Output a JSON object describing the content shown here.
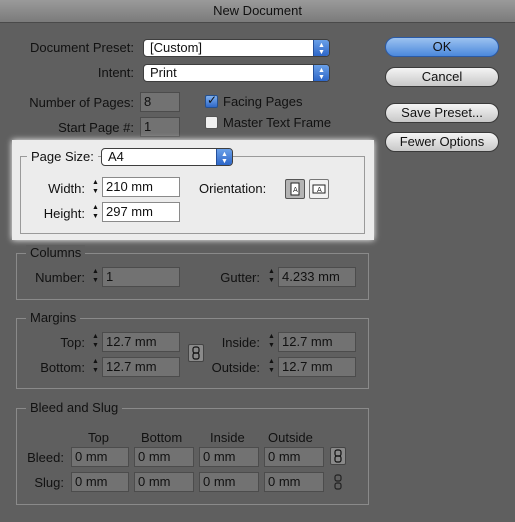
{
  "window": {
    "title": "New Document"
  },
  "document": {
    "preset_label": "Document Preset:",
    "preset_value": "[Custom]",
    "intent_label": "Intent:",
    "intent_value": "Print",
    "pages_label": "Number of Pages:",
    "pages_value": "8",
    "start_label": "Start Page #:",
    "start_value": "1",
    "facing_label": "Facing Pages",
    "facing_checked": true,
    "master_label": "Master Text Frame",
    "master_checked": false
  },
  "buttons": {
    "ok": "OK",
    "cancel": "Cancel",
    "save_preset": "Save Preset...",
    "fewer_options": "Fewer Options"
  },
  "page_size": {
    "label": "Page Size:",
    "value": "A4",
    "width_label": "Width:",
    "width_value": "210 mm",
    "height_label": "Height:",
    "height_value": "297 mm",
    "orientation_label": "Orientation:",
    "orientation_selected": "portrait"
  },
  "columns": {
    "title": "Columns",
    "number_label": "Number:",
    "number_value": "1",
    "gutter_label": "Gutter:",
    "gutter_value": "4.233 mm"
  },
  "margins": {
    "title": "Margins",
    "top_label": "Top:",
    "top_value": "12.7 mm",
    "bottom_label": "Bottom:",
    "bottom_value": "12.7 mm",
    "inside_label": "Inside:",
    "inside_value": "12.7 mm",
    "outside_label": "Outside:",
    "outside_value": "12.7 mm"
  },
  "bleed_slug": {
    "title": "Bleed and Slug",
    "headers": [
      "Top",
      "Bottom",
      "Inside",
      "Outside"
    ],
    "bleed_label": "Bleed:",
    "bleed_values": [
      "0 mm",
      "0 mm",
      "0 mm",
      "0 mm"
    ],
    "slug_label": "Slug:",
    "slug_values": [
      "0 mm",
      "0 mm",
      "0 mm",
      "0 mm"
    ]
  },
  "icons": {
    "spinner": "spinner-arrows-icon",
    "select_arrow": "select-arrows-icon",
    "link": "chain-link-icon",
    "portrait": "portrait-orientation-icon",
    "landscape": "landscape-orientation-icon"
  },
  "colors": {
    "dialog_bg": "#5f5f5f",
    "highlight_bg": "#ececec",
    "accent_blue": "#2d66c8"
  }
}
